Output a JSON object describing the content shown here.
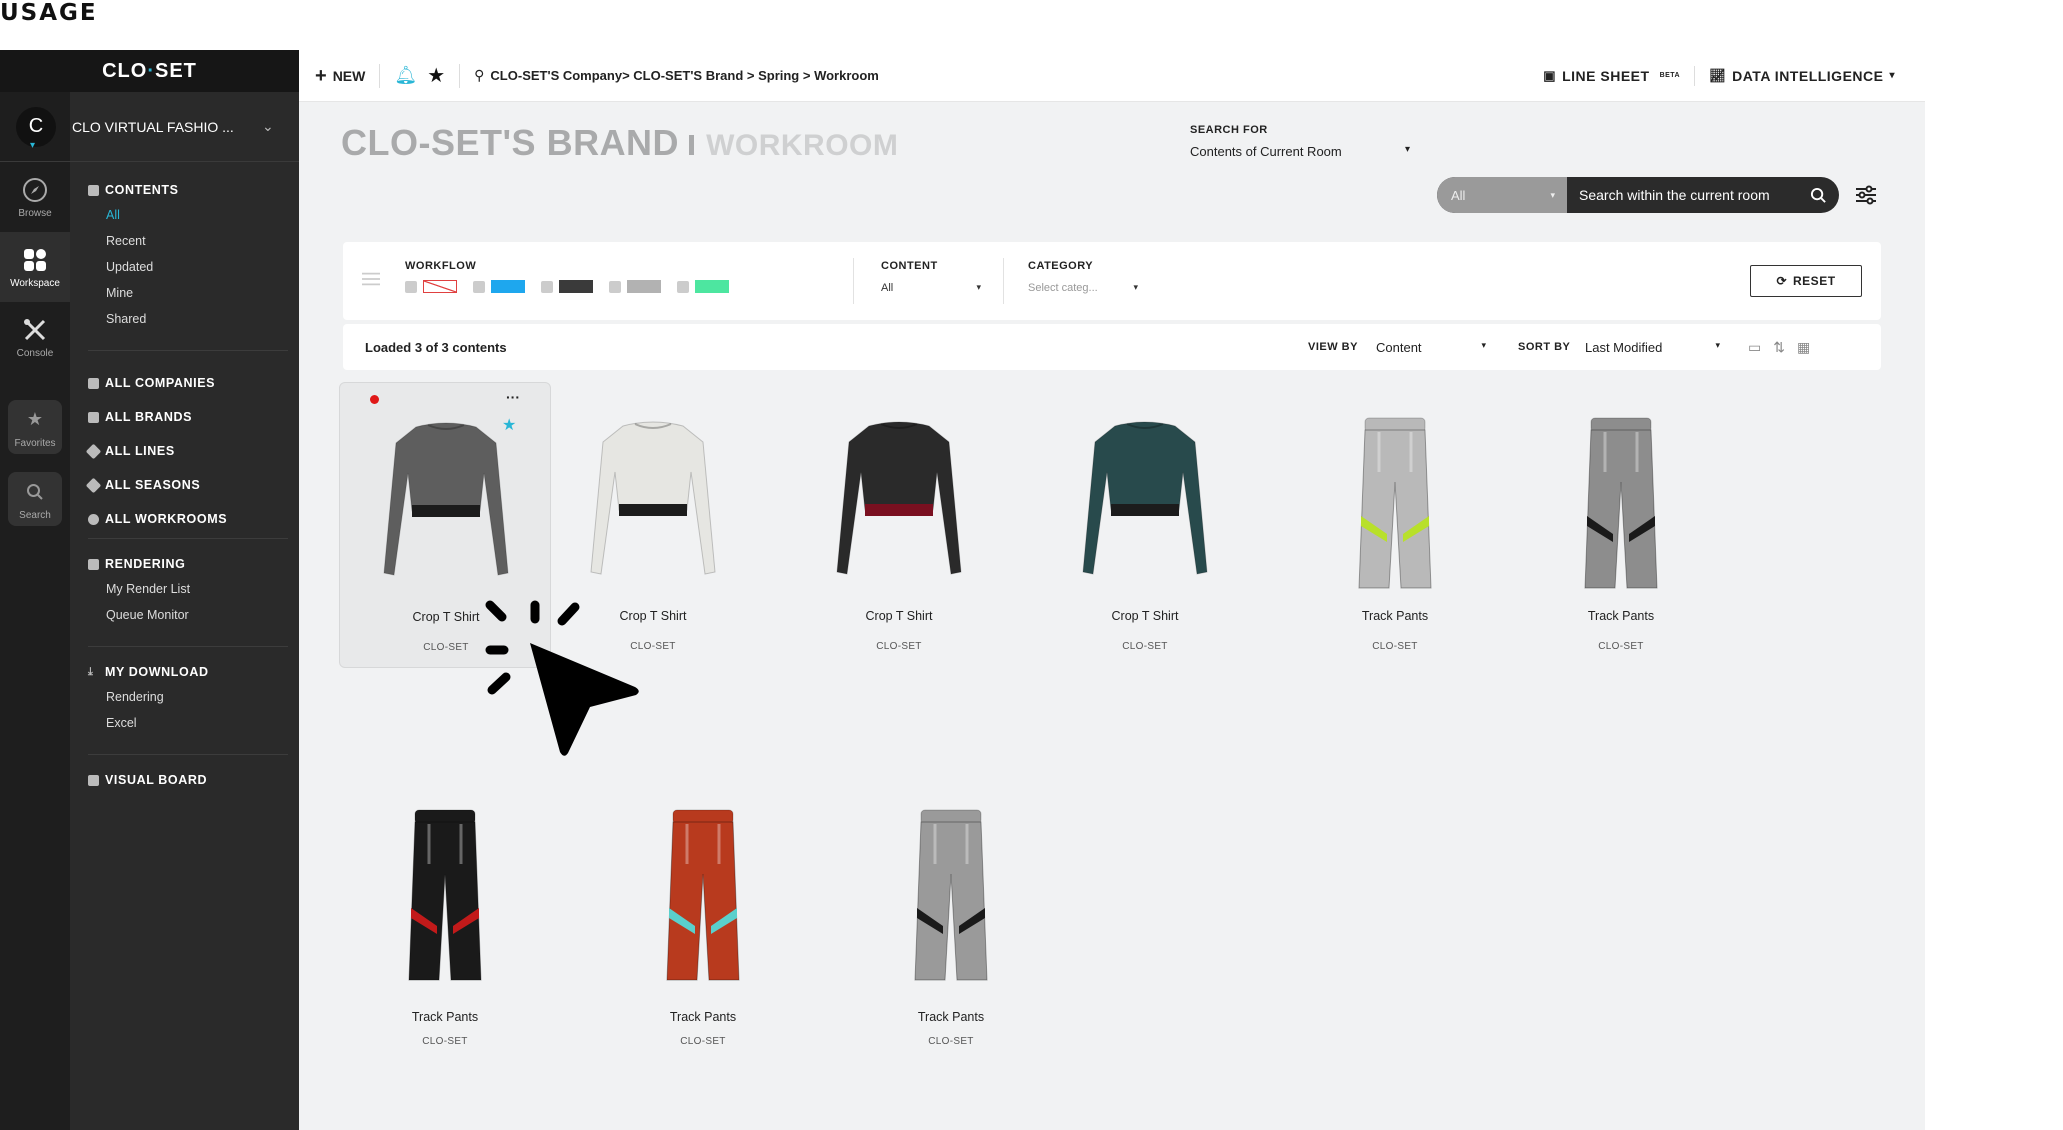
{
  "page_heading": "USAGE",
  "app": {
    "logo": {
      "left": "CLO",
      "dot": "·",
      "right": "SET"
    },
    "company": {
      "initial": "C",
      "name": "CLO VIRTUAL FASHIO ..."
    },
    "rail": [
      {
        "label": "Browse",
        "icon": "compass-icon"
      },
      {
        "label": "Workspace",
        "icon": "workspace-grid-icon"
      },
      {
        "label": "Console",
        "icon": "tools-icon"
      },
      {
        "label": "Favorites",
        "icon": "star-icon"
      },
      {
        "label": "Search",
        "icon": "search-icon"
      }
    ],
    "nav": {
      "contents": {
        "title": "CONTENTS",
        "items": [
          "All",
          "Recent",
          "Updated",
          "Mine",
          "Shared"
        ]
      },
      "org": [
        "ALL COMPANIES",
        "ALL BRANDS",
        "ALL LINES",
        "ALL SEASONS",
        "ALL WORKROOMS"
      ],
      "rendering": {
        "title": "RENDERING",
        "items": [
          "My Render List",
          "Queue Monitor"
        ]
      },
      "download": {
        "title": "MY DOWNLOAD",
        "items": [
          "Rendering",
          "Excel"
        ]
      },
      "visual_board": "VISUAL BOARD"
    },
    "topbar": {
      "new_label": "NEW",
      "breadcrumb": "CLO-SET'S Company> CLO-SET'S Brand > Spring > Workroom",
      "line_sheet": "LINE SHEET",
      "beta": "BETA",
      "data_intelligence": "DATA INTELLIGENCE"
    },
    "title": {
      "brand": "CLO-SET'S BRAND",
      "room": "WORKROOM"
    },
    "search": {
      "for_label": "SEARCH FOR",
      "for_value": "Contents of Current Room",
      "scope": "All",
      "placeholder": "Search within the current room"
    },
    "filters": {
      "workflow_label": "WORKFLOW",
      "workflow_colors": [
        "#ffffff",
        "#1ea7ee",
        "#3a3a3a",
        "#b2b2b2",
        "#4de6a0"
      ],
      "content_label": "CONTENT",
      "content_value": "All",
      "category_label": "CATEGORY",
      "category_value": "Select categ...",
      "reset": "RESET"
    },
    "info": {
      "loaded": "Loaded 3 of 3 contents",
      "view_by_label": "VIEW BY",
      "view_by_value": "Content",
      "sort_by_label": "SORT BY",
      "sort_by_value": "Last Modified"
    },
    "items": [
      {
        "name": "Crop T Shirt",
        "brand": "CLO-SET",
        "type": "top",
        "color": "#5e5e5e",
        "band": "#1c1c1c"
      },
      {
        "name": "Crop T Shirt",
        "brand": "CLO-SET",
        "type": "top",
        "color": "#e6e6e2",
        "band": "#1c1c1c"
      },
      {
        "name": "Crop T Shirt",
        "brand": "CLO-SET",
        "type": "top",
        "color": "#2a2a2a",
        "band": "#7a1020"
      },
      {
        "name": "Crop T Shirt",
        "brand": "CLO-SET",
        "type": "top",
        "color": "#284a4c",
        "band": "#1c1c1c"
      },
      {
        "name": "Track Pants",
        "brand": "CLO-SET",
        "type": "pants",
        "color": "#b9b9b9",
        "stripe": "#b8e02a"
      },
      {
        "name": "Track Pants",
        "brand": "CLO-SET",
        "type": "pants",
        "color": "#8d8d8d",
        "stripe": "#1a1a1a"
      },
      {
        "name": "Track Pants",
        "brand": "CLO-SET",
        "type": "pants",
        "color": "#1a1a1a",
        "stripe": "#c21a1a"
      },
      {
        "name": "Track Pants",
        "brand": "CLO-SET",
        "type": "pants",
        "color": "#b83a1e",
        "stripe": "#5ad0cc"
      },
      {
        "name": "Track Pants",
        "brand": "CLO-SET",
        "type": "pants",
        "color": "#9a9a9a",
        "stripe": "#1a1a1a"
      }
    ]
  }
}
